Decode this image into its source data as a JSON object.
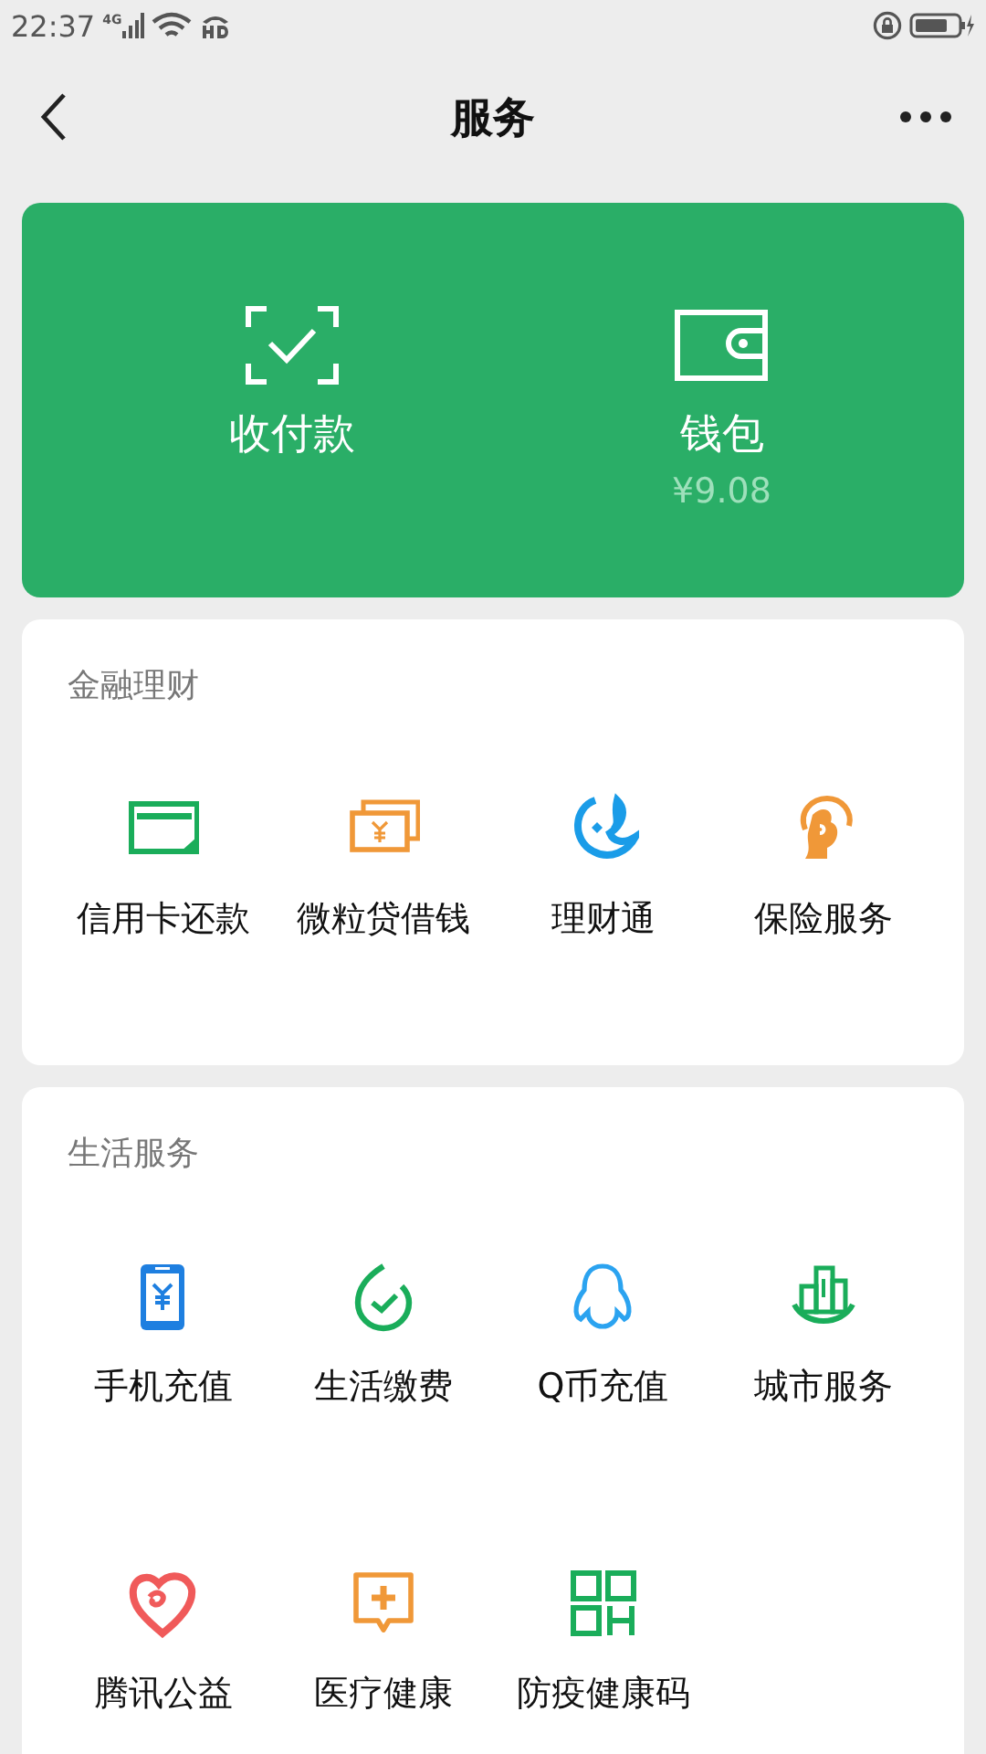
{
  "status_bar": {
    "time": "22:37",
    "network": "4G"
  },
  "header": {
    "title": "服务"
  },
  "top_card": {
    "items": [
      {
        "label": "收付款"
      },
      {
        "label": "钱包",
        "balance": "¥9.08"
      }
    ]
  },
  "sections": [
    {
      "title": "金融理财",
      "items": [
        {
          "label": "信用卡还款"
        },
        {
          "label": "微粒贷借钱"
        },
        {
          "label": "理财通"
        },
        {
          "label": "保险服务"
        }
      ]
    },
    {
      "title": "生活服务",
      "items": [
        {
          "label": "手机充值"
        },
        {
          "label": "生活缴费"
        },
        {
          "label": "Q币充值"
        },
        {
          "label": "城市服务"
        },
        {
          "label": "腾讯公益"
        },
        {
          "label": "医疗健康"
        },
        {
          "label": "防疫健康码"
        }
      ]
    }
  ]
}
